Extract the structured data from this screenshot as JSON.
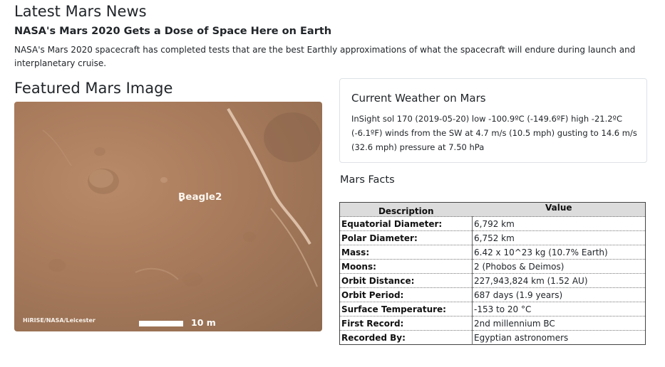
{
  "news": {
    "section_title": "Latest Mars News",
    "headline": "NASA's Mars 2020 Gets a Dose of Space Here on Earth",
    "teaser": "NASA's Mars 2020 spacecraft has completed tests that are the best Earthly approximations of what the spacecraft will endure during launch and interplanetary cruise."
  },
  "featured": {
    "section_title": "Featured Mars Image",
    "label": "Beagle2",
    "credit": "HiRISE/NASA/Leicester",
    "scale": "10 m"
  },
  "weather": {
    "title": "Current Weather on Mars",
    "text": "InSight sol 170 (2019-05-20) low -100.9ºC (-149.6ºF) high -21.2ºC (-6.1ºF) winds from the SW at 4.7 m/s (10.5 mph) gusting to 14.6 m/s (32.6 mph) pressure at 7.50 hPa"
  },
  "facts": {
    "title": "Mars Facts",
    "headers": [
      "Description",
      "Value"
    ],
    "rows": [
      {
        "label": "Equatorial Diameter:",
        "value": "6,792 km"
      },
      {
        "label": "Polar Diameter:",
        "value": "6,752 km"
      },
      {
        "label": "Mass:",
        "value": "6.42 x 10^23 kg (10.7% Earth)"
      },
      {
        "label": "Moons:",
        "value": "2 (Phobos & Deimos)"
      },
      {
        "label": "Orbit Distance:",
        "value": "227,943,824 km (1.52 AU)"
      },
      {
        "label": "Orbit Period:",
        "value": "687 days (1.9 years)"
      },
      {
        "label": "Surface Temperature:",
        "value": "-153 to 20 °C"
      },
      {
        "label": "First Record:",
        "value": "2nd millennium BC"
      },
      {
        "label": "Recorded By:",
        "value": "Egyptian astronomers"
      }
    ]
  }
}
